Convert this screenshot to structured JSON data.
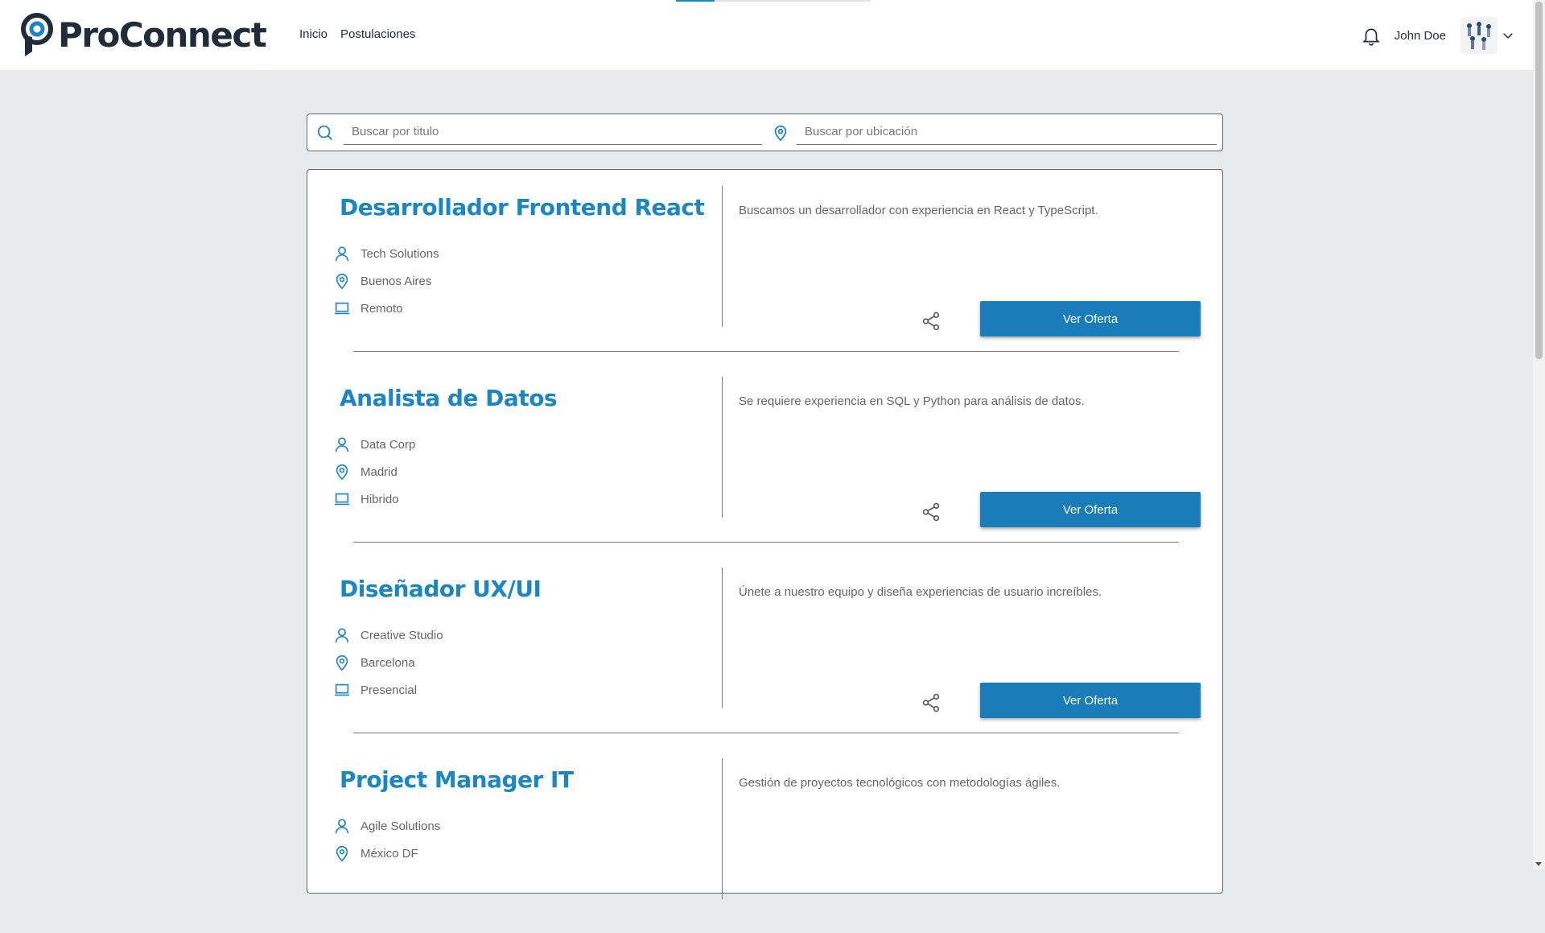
{
  "header": {
    "logo_text": "ProConnect",
    "nav": [
      {
        "label": "Inicio"
      },
      {
        "label": "Postulaciones"
      }
    ],
    "user_name": "John Doe"
  },
  "search": {
    "title_placeholder": "Buscar por titulo",
    "location_placeholder": "Buscar por ubicación"
  },
  "jobs": [
    {
      "title": "Desarrollador Frontend React",
      "company": "Tech Solutions",
      "location": "Buenos Aires",
      "modality": "Remoto",
      "description": "Buscamos un desarrollador con experiencia en React y TypeScript.",
      "button": "Ver Oferta"
    },
    {
      "title": "Analista de Datos",
      "company": "Data Corp",
      "location": "Madrid",
      "modality": "Hibrido",
      "description": "Se requiere experiencia en SQL y Python para análisis de datos.",
      "button": "Ver Oferta"
    },
    {
      "title": "Diseñador UX/UI",
      "company": "Creative Studio",
      "location": "Barcelona",
      "modality": "Presencial",
      "description": "Únete a nuestro equipo y diseña experiencias de usuario increíbles.",
      "button": "Ver Oferta"
    },
    {
      "title": "Project Manager IT",
      "company": "Agile Solutions",
      "location": "México DF",
      "modality": "",
      "description": "Gestión de proyectos tecnológicos con metodologías ágiles.",
      "button": ""
    }
  ],
  "colors": {
    "accent": "#1a86c4",
    "button": "#1a7dba",
    "background": "#e8e9eb"
  }
}
